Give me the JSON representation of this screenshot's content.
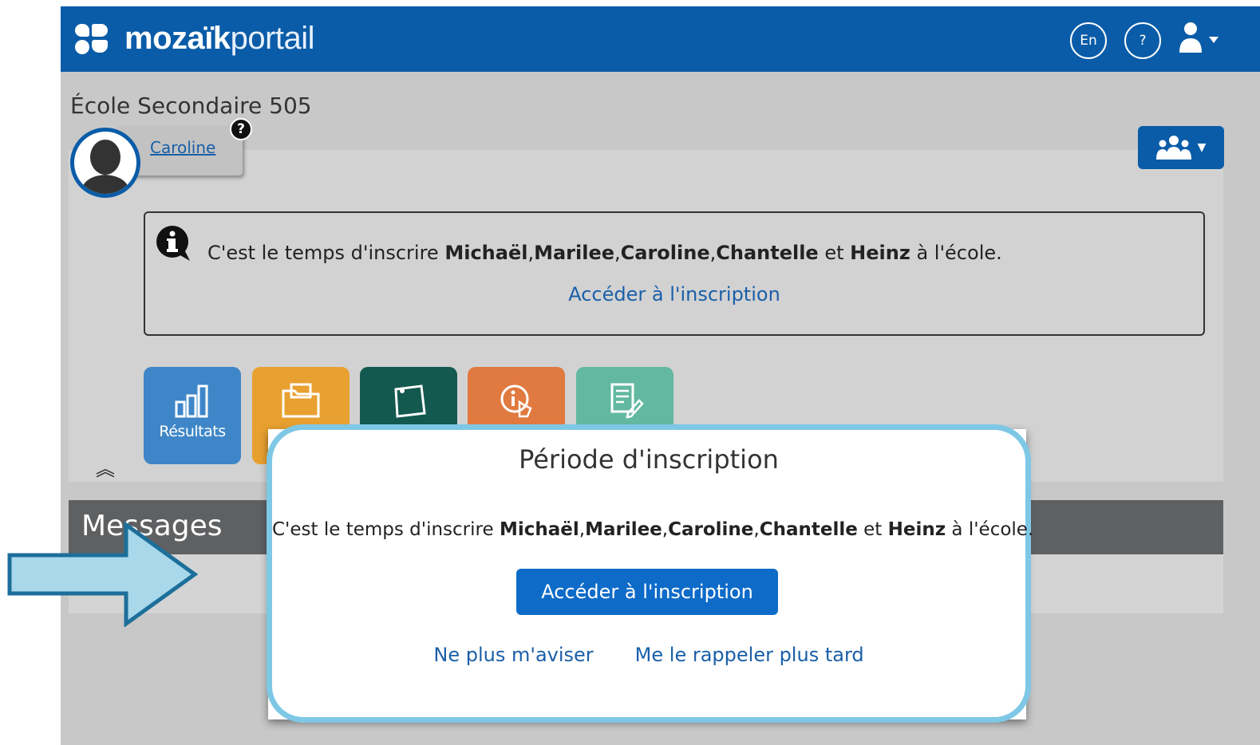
{
  "app": {
    "logo_bold": "mozaïk",
    "logo_light": "portail",
    "lang_button": "En",
    "help_button": "?"
  },
  "school": {
    "name": "École Secondaire 505"
  },
  "child": {
    "name": "Caroline",
    "help_badge": "?"
  },
  "info": {
    "prefix": "C'est le temps d'inscrire ",
    "names": [
      "Michaël",
      "Marilee",
      "Caroline",
      "Chantelle"
    ],
    "conjunction": " et ",
    "last_name": "Heinz",
    "suffix": " à l'école.",
    "link": "Accéder à l'inscription"
  },
  "tiles": [
    {
      "label": "Résultats",
      "color": "#3e86c8",
      "icon": "bar-chart-icon"
    },
    {
      "label": "",
      "color": "#e8a030",
      "icon": "folder-icon"
    },
    {
      "label": "",
      "color": "#13594f",
      "icon": "note-icon"
    },
    {
      "label": "",
      "color": "#e07a40",
      "icon": "info-hand-icon"
    },
    {
      "label": "",
      "color": "#62b8a0",
      "icon": "form-edit-icon"
    }
  ],
  "collapse_icon": "double-chevron-up-icon",
  "messages": {
    "title": "Messages"
  },
  "modal": {
    "title": "Période d'inscription",
    "prefix": "C'est le temps d'inscrire ",
    "names": [
      "Michaël",
      "Marilee",
      "Caroline",
      "Chantelle"
    ],
    "conjunction": " et ",
    "last_name": "Heinz",
    "suffix": " à l'école.",
    "primary_button": "Accéder à l'inscription",
    "dismiss_link": "Ne plus m'aviser",
    "remind_link": "Me le rappeler plus tard"
  },
  "colors": {
    "header_blue": "#0a5ca8",
    "link_blue": "#1a5fa8",
    "modal_border": "#7ec8e6",
    "arrow_fill": "#a8d8ea",
    "arrow_stroke": "#1c6f9a"
  }
}
